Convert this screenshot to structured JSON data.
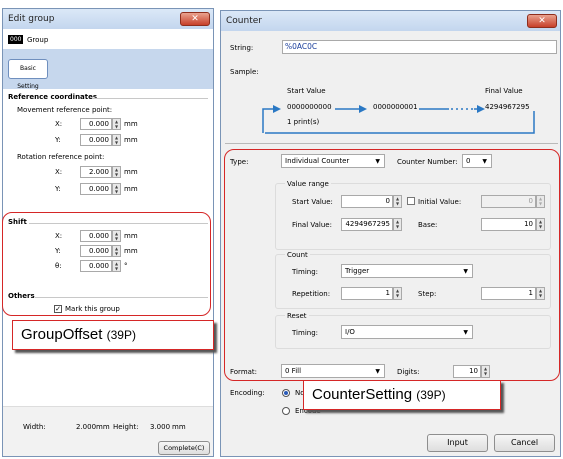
{
  "edit_group": {
    "title": "Edit group",
    "close_glyph": "✕",
    "group_badge": "000",
    "group_name": "Group",
    "basic_setting": "Basic Setting",
    "ref_coords": "Reference coordinates",
    "movement_ref": "Movement reference point:",
    "x_label": "X:",
    "y_label": "Y:",
    "theta_label": "θ:",
    "move_x": "0.000",
    "move_y": "0.000",
    "rotation_ref": "Rotation reference point:",
    "rot_x": "2.000",
    "rot_y": "0.000",
    "unit_mm": "mm",
    "unit_deg": "°",
    "shift": "Shift",
    "shift_x": "0.000",
    "shift_y": "0.000",
    "shift_theta": "0.000",
    "others": "Others",
    "mark_group": "Mark this group",
    "mark_checked": true,
    "width_label": "Width:",
    "width_val": "2.000",
    "width_unit": "mm",
    "height_label": "Height:",
    "height_val": "3.000",
    "height_unit": "mm",
    "complete": "Complete(C)"
  },
  "counter": {
    "title": "Counter",
    "close_glyph": "✕",
    "string_label": "String:",
    "string_val": "%0AC0C",
    "sample_label": "Sample:",
    "start_value_hdr": "Start Value",
    "final_value_hdr": "Final Value",
    "seq_first": "0000000000",
    "seq_second": "0000000001",
    "seq_final": "4294967295",
    "prints": "1 print(s)",
    "type_label": "Type:",
    "type_val": "Individual Counter",
    "counter_number_label": "Counter Number:",
    "counter_number_val": "0",
    "value_range": "Value range",
    "start_value_label": "Start Value:",
    "start_value": "0",
    "initial_value_label": "Initial Value:",
    "initial_value": "0",
    "final_value_label": "Final Value:",
    "final_value": "4294967295",
    "base_label": "Base:",
    "base_val": "10",
    "count": "Count",
    "timing_label": "Timing:",
    "count_timing": "Trigger",
    "repetition_label": "Repetition:",
    "repetition": "1",
    "step_label": "Step:",
    "step": "1",
    "reset": "Reset",
    "reset_timing": "I/O",
    "format_label": "Format:",
    "format_val": "0 Fill",
    "digits_label": "Digits:",
    "digits": "10",
    "encoding_label": "Encoding:",
    "enc_opt1": "No",
    "enc_opt2": "Encode",
    "input_btn": "Input",
    "cancel_btn": "Cancel"
  },
  "callouts": {
    "group_offset": "GroupOffset",
    "group_offset_pages": "(39P)",
    "counter_setting": "CounterSetting",
    "counter_setting_pages": "(39P)"
  },
  "colors": {
    "highlight": "#d52727",
    "title_bar": "#c3d6ee",
    "close": "#c7402a"
  }
}
